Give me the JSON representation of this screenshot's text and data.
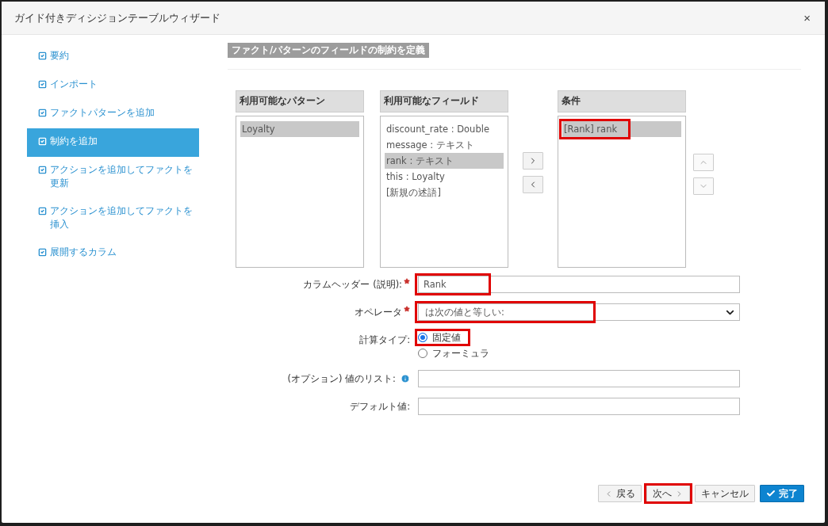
{
  "dialog": {
    "title": "ガイド付きディシジョンテーブルウィザード",
    "close": "×"
  },
  "steps": [
    {
      "label": "要約",
      "selected": false
    },
    {
      "label": "インポート",
      "selected": false
    },
    {
      "label": "ファクトパターンを追加",
      "selected": false
    },
    {
      "label": "制約を追加",
      "selected": true
    },
    {
      "label": "アクションを追加してファクトを更新",
      "selected": false
    },
    {
      "label": "アクションを追加してファクトを挿入",
      "selected": false
    },
    {
      "label": "展開するカラム",
      "selected": false
    }
  ],
  "section_title": "ファクト/パターンのフィールドの制約を定義",
  "patterns": {
    "header": "利用可能なパターン",
    "items": [
      {
        "label": "Loyalty",
        "selected": true,
        "highlighted": false
      }
    ]
  },
  "fields": {
    "header": "利用可能なフィールド",
    "items": [
      {
        "label": "discount_rate : Double",
        "selected": false,
        "highlighted": false
      },
      {
        "label": "message : テキスト",
        "selected": false,
        "highlighted": false
      },
      {
        "label": "rank : テキスト",
        "selected": true,
        "highlighted": false
      },
      {
        "label": "this : Loyalty",
        "selected": false,
        "highlighted": false
      },
      {
        "label": "[新規の述語]",
        "selected": false,
        "highlighted": false
      }
    ]
  },
  "conditions": {
    "header": "条件",
    "items": [
      {
        "label": "[Rank] rank",
        "selected": true,
        "highlighted": true
      }
    ]
  },
  "form": [
    {
      "kind": "text",
      "label": "カラムヘッダー (説明):",
      "required": true,
      "value": "Rank",
      "highlighted": true
    },
    {
      "kind": "select",
      "label": "オペレータ",
      "required": true,
      "value": "は次の値と等しい:",
      "highlighted": true
    },
    {
      "kind": "radio",
      "label": "計算タイプ:",
      "options": [
        {
          "label": "固定値",
          "selected": true,
          "highlighted": true
        },
        {
          "label": "フォーミュラ",
          "selected": false,
          "highlighted": false
        }
      ]
    },
    {
      "kind": "text",
      "label": "(オプション) 値のリスト:",
      "info": true
    },
    {
      "kind": "text",
      "label": "デフォルト値:"
    }
  ],
  "buttons": [
    {
      "kind": "back",
      "label": "戻る",
      "highlighted": false
    },
    {
      "kind": "next",
      "label": "次へ",
      "highlighted": true
    },
    {
      "kind": "cancel",
      "label": "キャンセル",
      "highlighted": false
    },
    {
      "kind": "finish",
      "label": "完了",
      "highlighted": false
    }
  ]
}
